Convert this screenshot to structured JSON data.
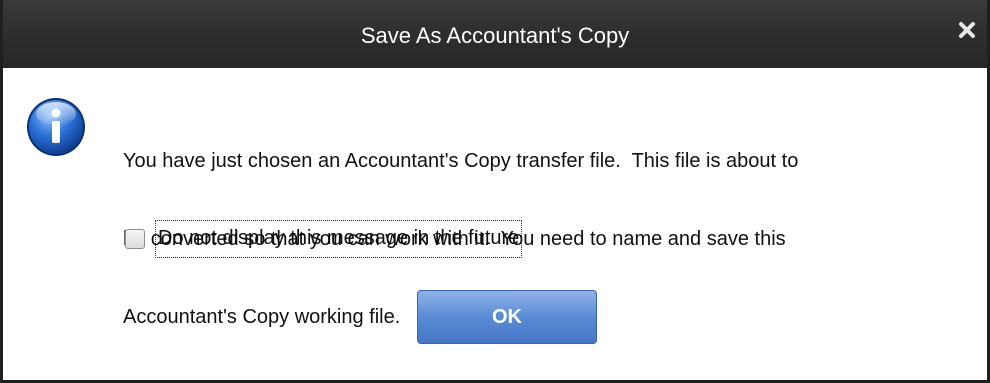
{
  "dialog": {
    "title": "Save As Accountant's Copy",
    "close_icon": "close-icon",
    "info_icon": "info-icon",
    "message_lines": [
      "You have just chosen an Accountant's Copy transfer file.  This file is about to",
      "be converted so that you can work with it.  You need to name and save this",
      "Accountant's Copy working file."
    ],
    "checkbox": {
      "label": "Do not display this message in the future",
      "checked": false
    },
    "ok_label": "OK"
  },
  "colors": {
    "titlebar": "#2e2e2e",
    "title_text": "#ffffff",
    "ok_button": "#5a8bd6",
    "info_icon": "#1f5fbf"
  }
}
